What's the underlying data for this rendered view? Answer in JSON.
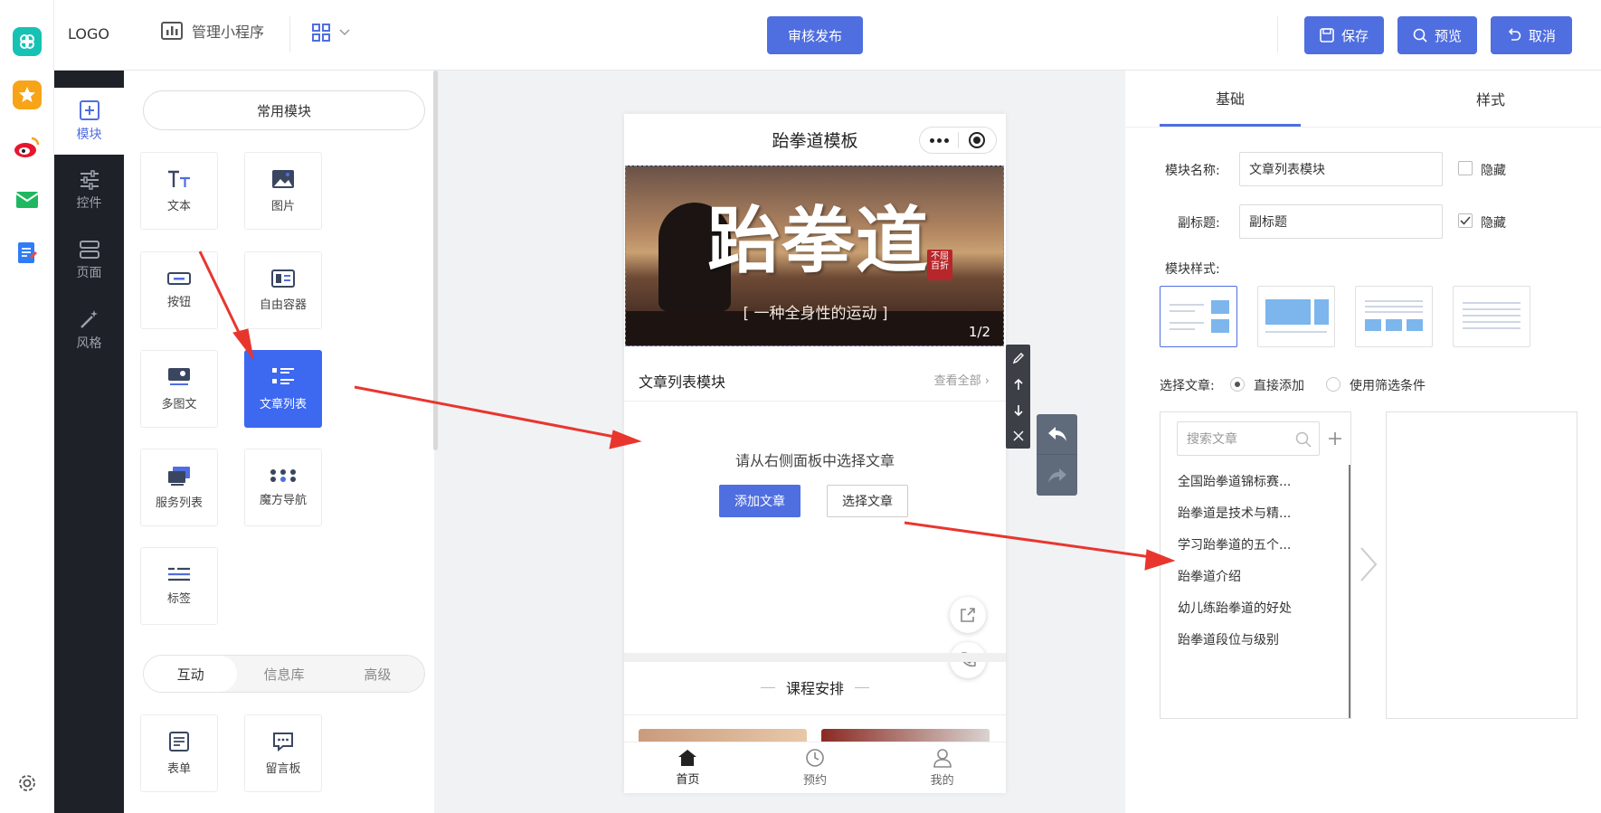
{
  "header": {
    "logo": "LOGO",
    "manage_label": "管理小程序",
    "publish_label": "审核发布",
    "save_label": "保存",
    "preview_label": "预览",
    "cancel_label": "取消"
  },
  "side_nav": [
    {
      "label": "模块"
    },
    {
      "label": "控件"
    },
    {
      "label": "页面"
    },
    {
      "label": "风格"
    }
  ],
  "module_panel": {
    "common_label": "常用模块",
    "tiles": [
      "文本",
      "图片",
      "按钮",
      "自由容器",
      "多图文",
      "文章列表",
      "服务列表",
      "魔方导航",
      "标签"
    ],
    "tabs": [
      "互动",
      "信息库",
      "高级"
    ],
    "lower_tiles": [
      "表单",
      "留言板"
    ]
  },
  "phone": {
    "title": "跆拳道模板",
    "banner_title": "跆拳道",
    "banner_stamp": "不屈 百折",
    "banner_sub": "[ 一种全身性的运动 ]",
    "banner_page": "1/2",
    "section_title": "文章列表模块",
    "view_all": "查看全部",
    "empty_hint": "请从右侧面板中选择文章",
    "add_article": "添加文章",
    "select_article": "选择文章",
    "course_title": "课程安排",
    "tabs": [
      "首页",
      "预约",
      "我的"
    ]
  },
  "right_panel": {
    "tabs": [
      "基础",
      "样式"
    ],
    "name_label": "模块名称:",
    "name_value": "文章列表模块",
    "subtitle_label": "副标题:",
    "subtitle_value": "副标题",
    "hide_label": "隐藏",
    "style_label": "模块样式:",
    "choose_label": "选择文章:",
    "direct_add": "直接添加",
    "filter_cond": "使用筛选条件",
    "search_placeholder": "搜索文章",
    "articles": [
      "全国跆拳道锦标赛...",
      "跆拳道是技术与精...",
      "学习跆拳道的五个...",
      "跆拳道介绍",
      "幼儿练跆拳道的好处",
      "跆拳道段位与级别"
    ]
  },
  "colors": {
    "accent": "#4f6ee0",
    "active_tile": "#3d68f0",
    "dark_nav": "#1e2127",
    "arrow": "#e8362f"
  }
}
